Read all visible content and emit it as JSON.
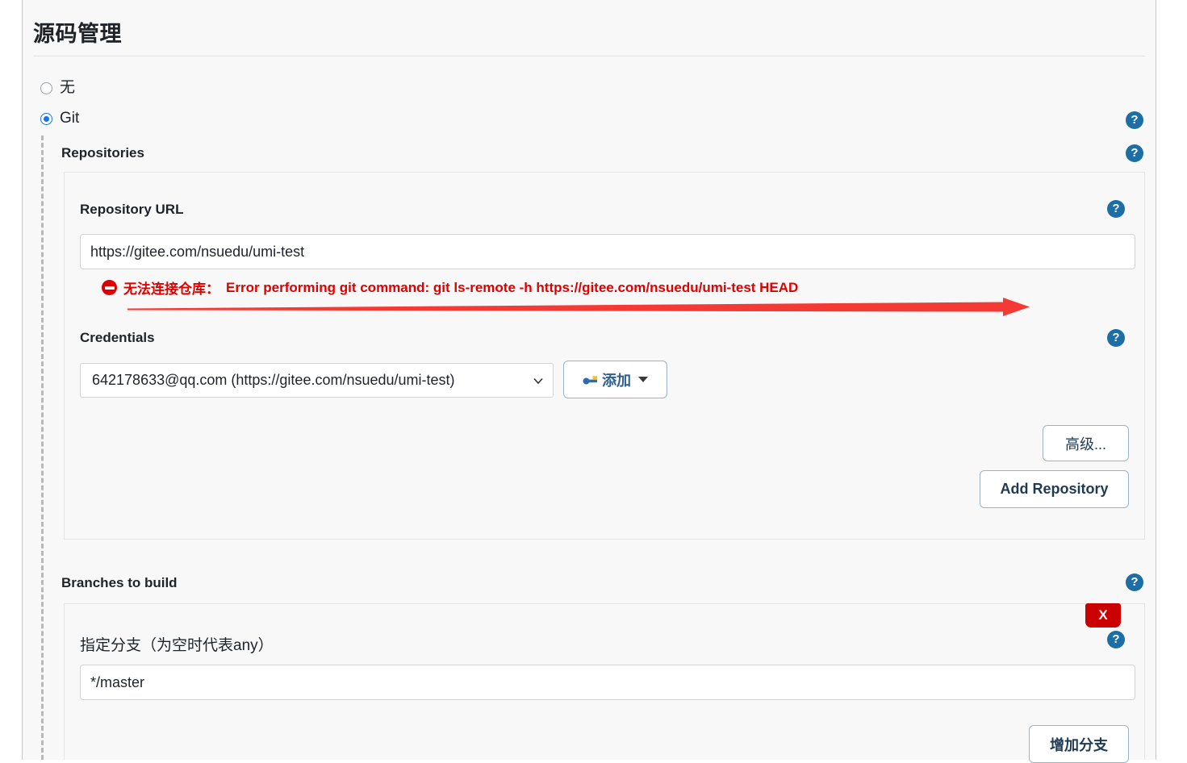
{
  "page": {
    "section_title": "源码管理"
  },
  "scm_options": [
    {
      "label": "无",
      "selected": false,
      "name": "scm-none"
    },
    {
      "label": "Git",
      "selected": true,
      "name": "scm-git"
    }
  ],
  "repositories": {
    "group_label": "Repositories",
    "url_field": {
      "label": "Repository URL",
      "value": "https://gitee.com/nsuedu/umi-test",
      "placeholder": ""
    },
    "error": {
      "prefix": "无法连接仓库：",
      "message": "Error performing git command: git ls-remote -h https://gitee.com/nsuedu/umi-test HEAD",
      "color": "#e00000"
    },
    "credentials_field": {
      "label": "Credentials",
      "selected_value": "642178633@qq.com (https://gitee.com/nsuedu/umi-test)",
      "add_button_label": "添加"
    },
    "advanced_button_label": "高级...",
    "add_repository_button_label": "Add Repository"
  },
  "branches": {
    "group_label": "Branches to build",
    "delete_label": "X",
    "branch_field": {
      "label": "指定分支（为空时代表any）",
      "value": "*/master",
      "placeholder": ""
    },
    "add_branch_button_label": "增加分支"
  },
  "help_icon_glyph": "?",
  "colors": {
    "accent_blue": "#1a73e8",
    "help_blue": "#1c6ea4",
    "error_red": "#e00000",
    "delete_red": "#cc0000",
    "annotation_red": "#f33a34",
    "panel_bg": "#f8f8f8"
  }
}
